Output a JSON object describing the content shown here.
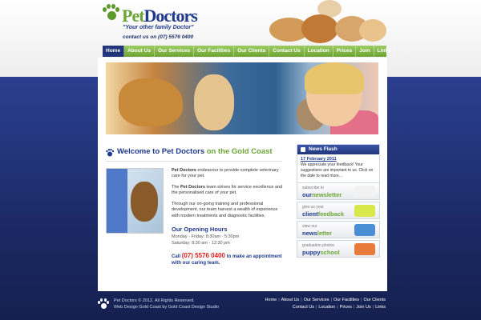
{
  "header": {
    "logo_pet": "Pet",
    "logo_doctors": "Doctors",
    "tagline": "\"Your other family Doctor\"",
    "contact": "contact us on (07) 5576 0400"
  },
  "nav": {
    "items": [
      "Home",
      "About Us",
      "Our Services",
      "Our Facilities",
      "Our Clients",
      "Contact Us",
      "Location",
      "Prices",
      "Join",
      "Links"
    ],
    "active": "Home"
  },
  "welcome": {
    "title_blue": "Welcome to Pet Doctors",
    "title_green": "on the Gold Coast",
    "para1_bold": "Pet Doctors",
    "para1": "endeavour to provide complete veterinary care for your pet.",
    "para2_pre": "The",
    "para2_bold": "Pet Doctors",
    "para2": "team strives for service excellence and the personalised care of your pet.",
    "para3": "Through our on-going training and professional development, our team harvest a wealth of experience with modern treatments and diagnostic facilities.",
    "hours_title": "Our Opening Hours",
    "hours_weekday": "Monday - Friday: 8:30am - 5:30pm",
    "hours_saturday": "Saturday: 8:30 am - 12:30 pm",
    "call_pre": "Call",
    "call_phone": "(07) 5576 0400",
    "call_post": "to make an appointment with our caring team."
  },
  "news": {
    "heading": "News Flash",
    "date": "17 February 2011",
    "text": "We appreciate your feedback! Your suggestions are important to us. Click on the date to read more..."
  },
  "promos": [
    {
      "small": "subscribe to",
      "big_a": "our",
      "big_b": "newsletter",
      "color": "#f2f2f2"
    },
    {
      "small": "give us your",
      "big_a": "client",
      "big_b": "feedback",
      "color": "#d8e84a"
    },
    {
      "small": "view our",
      "big_a": "news",
      "big_b": "letter",
      "color": "#4a8fd6"
    },
    {
      "small": "graduation photos",
      "big_a": "puppy",
      "big_b": "school",
      "color": "#e87b3a"
    }
  ],
  "footer": {
    "copyright": "Pet Doctors © 2012. All Rights Reserved.",
    "credit": "Web Design Gold Coast by Gold Coast Design Studio",
    "links_row1": [
      "Home",
      "About Us",
      "Our Services",
      "Our Facilities",
      "Our Clients"
    ],
    "links_row2": [
      "Contact Us",
      "Location",
      "Prices",
      "Join Us",
      "Links"
    ]
  },
  "colors": {
    "brand_green": "#6aa436",
    "brand_blue": "#1f3a8c",
    "background_blue": "#22357a",
    "phone_red": "#e01d1d"
  }
}
